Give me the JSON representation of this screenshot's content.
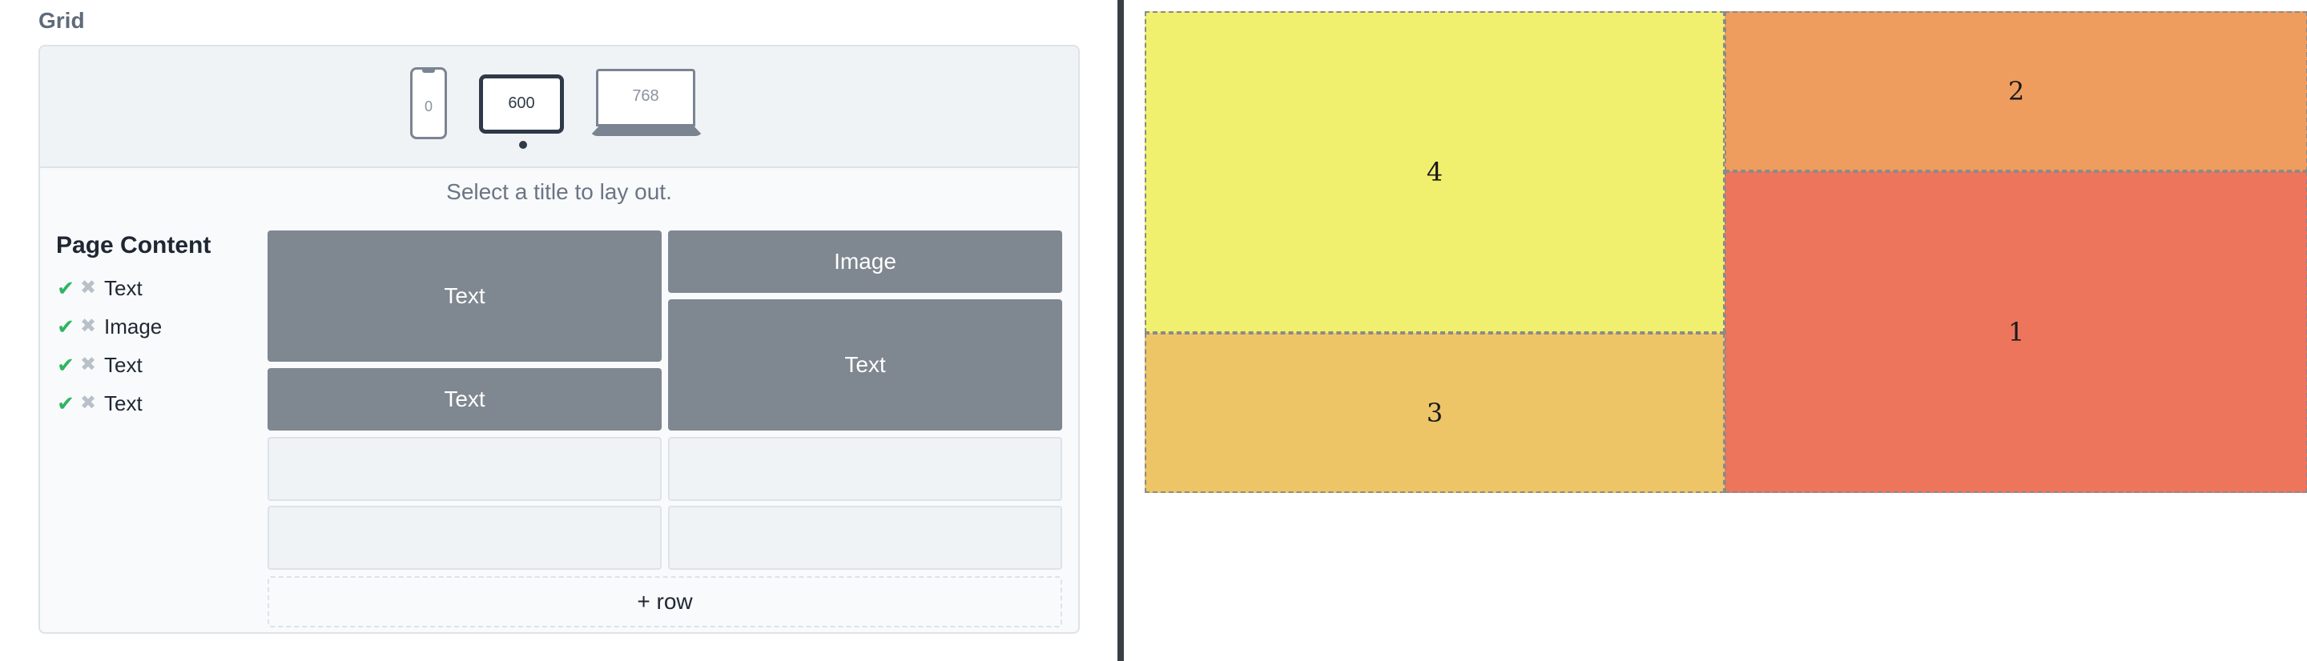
{
  "section_title": "Grid",
  "devices": [
    {
      "label": "0",
      "name": "phone"
    },
    {
      "label": "600",
      "name": "tablet",
      "selected": true
    },
    {
      "label": "768",
      "name": "laptop"
    }
  ],
  "instruction": "Select a title to lay out.",
  "page_content": {
    "heading": "Page Content",
    "items": [
      {
        "label": "Text"
      },
      {
        "label": "Image"
      },
      {
        "label": "Text"
      },
      {
        "label": "Text"
      }
    ],
    "icons": {
      "check": "check-icon",
      "remove": "x-icon"
    }
  },
  "grid": {
    "cells": [
      {
        "label": "Text"
      },
      {
        "label": "Image"
      },
      {
        "label": "Text"
      },
      {
        "label": "Text"
      }
    ],
    "add_row_label": "+ row"
  },
  "preview": {
    "tiles": [
      {
        "label": "4",
        "color": "#F0F06E"
      },
      {
        "label": "2",
        "color": "#EE9D5F"
      },
      {
        "label": "1",
        "color": "#ED755C"
      },
      {
        "label": "3",
        "color": "#EDC567"
      }
    ]
  }
}
